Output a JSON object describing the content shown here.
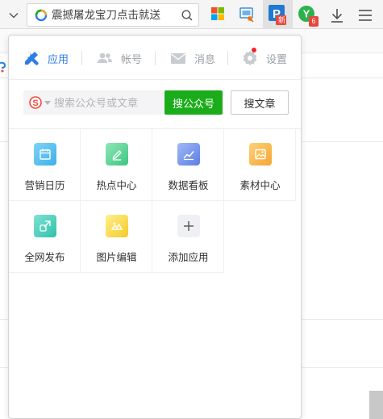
{
  "browser": {
    "search_text": "震撼屠龙宝刀点击就送",
    "extension_badges": {
      "p_badge": "新",
      "y_badge": "6"
    }
  },
  "popup": {
    "tabs": [
      {
        "label": "应用",
        "icon": "apps-icon",
        "active": true
      },
      {
        "label": "帐号",
        "icon": "account-icon",
        "active": false
      },
      {
        "label": "消息",
        "icon": "message-icon",
        "active": false
      },
      {
        "label": "设置",
        "icon": "settings-icon",
        "active": false,
        "has_notification": true
      }
    ],
    "search": {
      "placeholder": "搜索公众号或文章",
      "search_accounts_label": "搜公众号",
      "search_articles_label": "搜文章"
    },
    "apps": [
      {
        "label": "营销日历",
        "icon": "calendar-icon"
      },
      {
        "label": "热点中心",
        "icon": "hot-topics-icon"
      },
      {
        "label": "数据看板",
        "icon": "data-dashboard-icon"
      },
      {
        "label": "素材中心",
        "icon": "material-center-icon"
      },
      {
        "label": "全网发布",
        "icon": "publish-icon"
      },
      {
        "label": "图片编辑",
        "icon": "image-edit-icon"
      },
      {
        "label": "添加应用",
        "icon": "add-app-icon"
      }
    ]
  },
  "colors": {
    "accent_blue": "#2e7ee6",
    "green_button": "#1aad19",
    "muted_gray": "#9aa0a6",
    "notification_red": "#f5222d"
  }
}
